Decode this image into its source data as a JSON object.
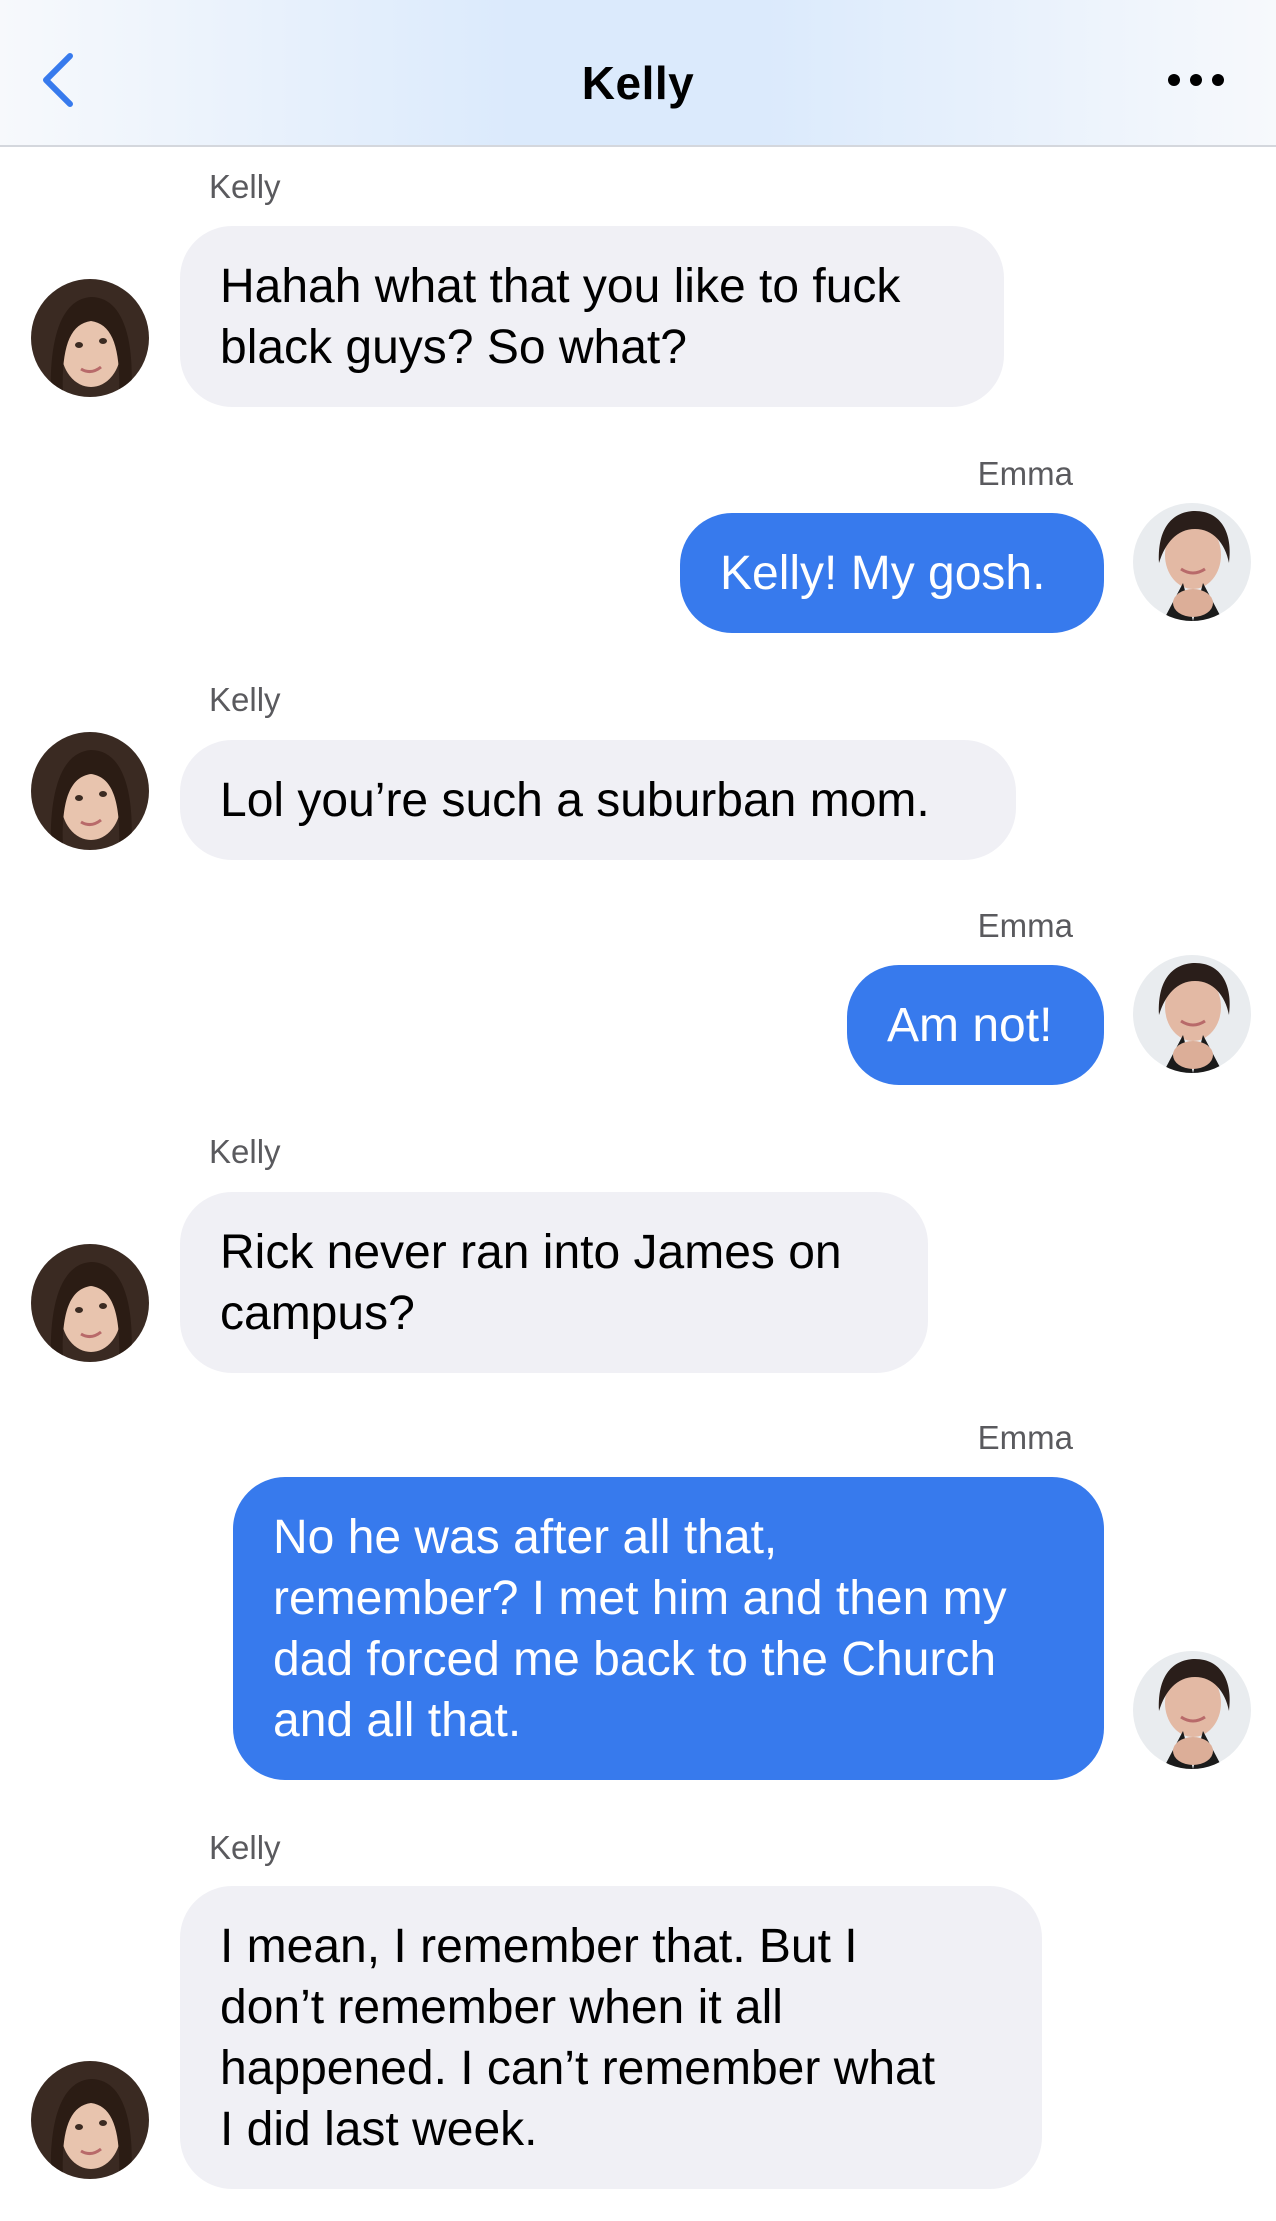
{
  "header": {
    "title": "Kelly",
    "back_icon": "chevron-left-icon",
    "more_icon": "more-horizontal-icon",
    "accent_color": "#377aed"
  },
  "messages": [
    {
      "sender": "Kelly",
      "direction": "incoming",
      "text": "Hahah what that you like to fuck\nblack guys? So what?"
    },
    {
      "sender": "Emma",
      "direction": "outgoing",
      "text": "Kelly! My gosh."
    },
    {
      "sender": "Kelly",
      "direction": "incoming",
      "text": "Lol you’re such a suburban mom."
    },
    {
      "sender": "Emma",
      "direction": "outgoing",
      "text": "Am not!"
    },
    {
      "sender": "Kelly",
      "direction": "incoming",
      "text": "Rick never ran into James on\ncampus?"
    },
    {
      "sender": "Emma",
      "direction": "outgoing",
      "text": "No he was after all that,\nremember? I met him and then my\ndad forced me back to the Church\nand all that."
    },
    {
      "sender": "Kelly",
      "direction": "incoming",
      "text": "I mean, I remember that. But I\ndon’t remember when it all\nhappened. I can’t remember what\nI did last week."
    }
  ],
  "colors": {
    "incoming_bubble": "#f0f0f5",
    "outgoing_bubble": "#377aed"
  }
}
